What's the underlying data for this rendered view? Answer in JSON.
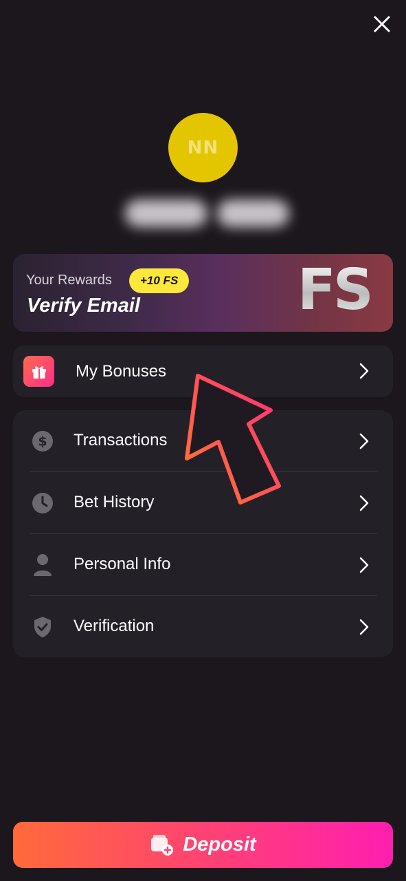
{
  "header": {
    "close_icon": "close-icon"
  },
  "profile": {
    "initials": "NN",
    "avatar_color": "#e3c600",
    "name_hidden": true
  },
  "rewards": {
    "label": "Your Rewards",
    "badge": "+10 FS",
    "title": "Verify Email",
    "logo": "FS"
  },
  "bonuses": {
    "label": "My Bonuses",
    "icon": "gift-icon"
  },
  "menu": {
    "items": [
      {
        "label": "Transactions",
        "icon": "dollar-coin-icon"
      },
      {
        "label": "Bet History",
        "icon": "clock-icon"
      },
      {
        "label": "Personal Info",
        "icon": "user-icon"
      },
      {
        "label": "Verification",
        "icon": "shield-check-icon"
      }
    ]
  },
  "deposit": {
    "label": "Deposit",
    "icon": "wallet-plus-icon"
  },
  "colors": {
    "background": "#1b171d",
    "card": "#242028",
    "accent_start": "#ff6a3a",
    "accent_end": "#ff1eb0",
    "badge": "#fbe83a"
  }
}
